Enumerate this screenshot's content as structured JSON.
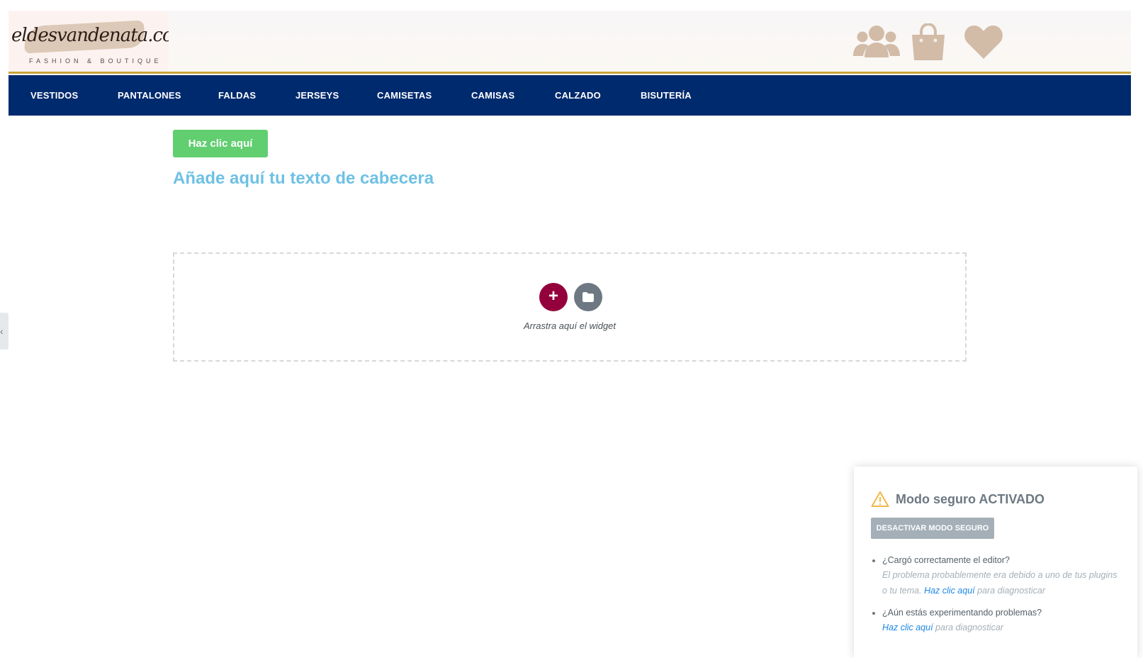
{
  "header": {
    "logo_text": "eldesvandenata.com",
    "logo_subtitle": "FASHION & BOUTIQUE",
    "icons": [
      "users-icon",
      "shopping-bag-icon",
      "heart-icon"
    ],
    "icon_color": "#d2bca7",
    "accent_line_color": "#c9a43a"
  },
  "nav": {
    "background": "#002a6e",
    "items": [
      "VESTIDOS",
      "PANTALONES",
      "FALDAS",
      "JERSEYS",
      "CAMISETAS",
      "CAMISAS",
      "CALZADO",
      "BISUTERÍA"
    ]
  },
  "content": {
    "button_label": "Haz clic aquí",
    "heading": "Añade aquí tu texto de cabecera",
    "drop_zone": {
      "add_symbol": "+",
      "label": "Arrastra aquí el widget"
    }
  },
  "panel_toggle": "‹",
  "safe_mode": {
    "title": "Modo seguro ACTIVADO",
    "deactivate_label": "DESACTIVAR MODO SEGURO",
    "q1": "¿Cargó correctamente el editor?",
    "q1_hint_pre": "El problema probablemente era debido a uno de tus plugins o tu tema.",
    "q1_link": "Haz clic aquí",
    "q1_hint_post": "para diagnosticar",
    "q2": "¿Aún estás experimentando problemas?",
    "q2_link": "Haz clic aquí",
    "q2_hint_post": "para diagnosticar"
  }
}
